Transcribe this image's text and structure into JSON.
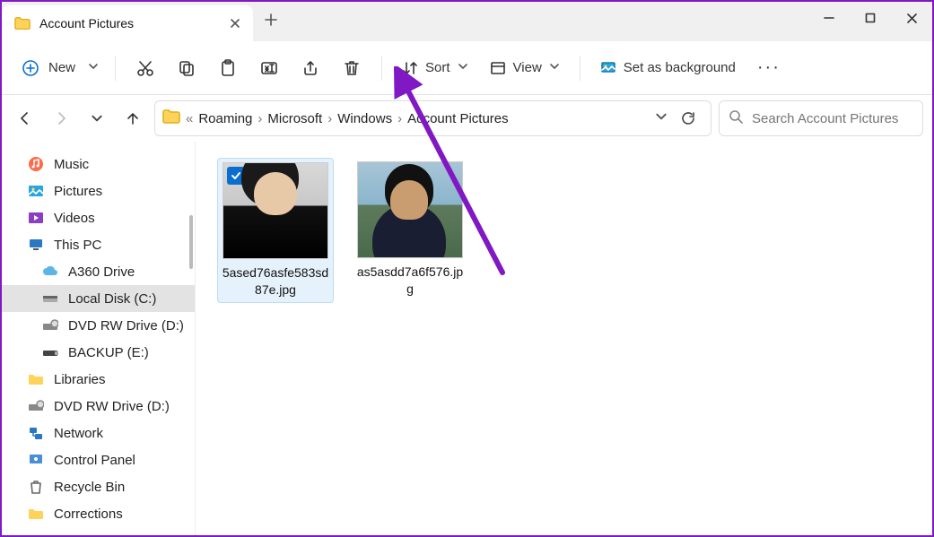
{
  "tab": {
    "title": "Account Pictures"
  },
  "toolbar": {
    "new_label": "New",
    "sort_label": "Sort",
    "view_label": "View",
    "bg_label": "Set as background"
  },
  "breadcrumb": {
    "items": [
      "Roaming",
      "Microsoft",
      "Windows",
      "Account Pictures"
    ]
  },
  "search": {
    "placeholder": "Search Account Pictures"
  },
  "sidebar": {
    "items": [
      {
        "label": "Music",
        "icon": "music"
      },
      {
        "label": "Pictures",
        "icon": "pictures"
      },
      {
        "label": "Videos",
        "icon": "videos"
      },
      {
        "label": "This PC",
        "icon": "thispc"
      },
      {
        "label": "A360 Drive",
        "icon": "cloud"
      },
      {
        "label": "Local Disk (C:)",
        "icon": "disk",
        "selected": true
      },
      {
        "label": "DVD RW Drive (D:)",
        "icon": "dvd"
      },
      {
        "label": "BACKUP (E:)",
        "icon": "usb"
      },
      {
        "label": "Libraries",
        "icon": "folder"
      },
      {
        "label": "DVD RW Drive (D:)",
        "icon": "dvd"
      },
      {
        "label": "Network",
        "icon": "network"
      },
      {
        "label": "Control Panel",
        "icon": "control"
      },
      {
        "label": "Recycle Bin",
        "icon": "recycle"
      },
      {
        "label": "Corrections",
        "icon": "folder"
      }
    ]
  },
  "files": [
    {
      "name": "5ased76asfe583sd87e.jpg",
      "selected": true
    },
    {
      "name": "as5asdd7a6f576.jpg",
      "selected": false
    }
  ]
}
